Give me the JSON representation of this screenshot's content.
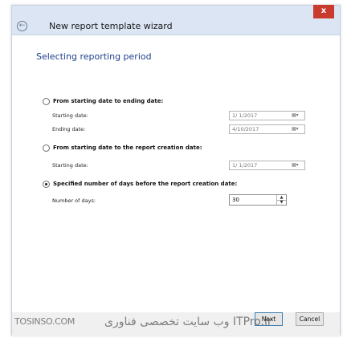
{
  "window": {
    "title": "New report template wizard",
    "close_label": "x",
    "back_glyph": "←"
  },
  "heading": "Selecting reporting period",
  "options": [
    {
      "label": "From starting date to ending date:",
      "selected": false,
      "fields": [
        {
          "label": "Starting date:",
          "value": "1/ 1/2017"
        },
        {
          "label": "Ending date:",
          "value": "4/10/2017"
        }
      ]
    },
    {
      "label": "From starting date to the report creation date:",
      "selected": false,
      "fields": [
        {
          "label": "Starting date:",
          "value": "1/ 1/2017"
        }
      ]
    },
    {
      "label": "Specified number of days before the report creation date:",
      "selected": true,
      "fields": [
        {
          "label": "Number of days:",
          "value": "30"
        }
      ]
    }
  ],
  "icons": {
    "calendar": "calendar-dropdown-icon",
    "spin_up": "▲",
    "spin_down": "▼"
  },
  "buttons": {
    "next": "Next",
    "cancel": "Cancel"
  },
  "watermark": {
    "left": "TOSINSO.COM",
    "right": "وب سایت تخصصی فناوری ITPro.ir"
  }
}
